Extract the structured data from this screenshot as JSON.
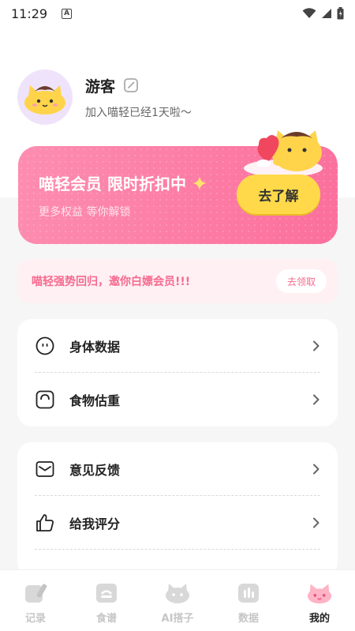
{
  "status_bar": {
    "time": "11:29",
    "notification_letter": "A"
  },
  "profile": {
    "name": "游客",
    "subtitle": "加入喵轻已经1天啦～"
  },
  "vip_card": {
    "title": "喵轻会员 限时折扣中",
    "subtitle": "更多权益 等你解锁",
    "button_label": "去了解"
  },
  "promo": {
    "text": "喵轻强势回归，邀你白嫖会员!!!",
    "button_label": "去领取"
  },
  "menu_group_1": [
    {
      "label": "身体数据",
      "icon": "face-icon"
    },
    {
      "label": "食物估重",
      "icon": "scale-icon"
    }
  ],
  "menu_group_2": [
    {
      "label": "意见反馈",
      "icon": "mail-icon"
    },
    {
      "label": "给我评分",
      "icon": "thumbs-up-icon"
    }
  ],
  "tabs": [
    {
      "label": "记录",
      "icon": "record-icon",
      "active": false
    },
    {
      "label": "食谱",
      "icon": "recipe-icon",
      "active": false
    },
    {
      "label": "AI搭子",
      "icon": "ai-cat-icon",
      "active": false
    },
    {
      "label": "数据",
      "icon": "data-icon",
      "active": false
    },
    {
      "label": "我的",
      "icon": "profile-cat-icon",
      "active": true
    }
  ],
  "colors": {
    "vip_gradient_start": "#fd8db1",
    "vip_gradient_end": "#fb6f9c",
    "vip_button": "#ffd94a",
    "promo_text": "#f66a8e",
    "avatar_bg": "#efe3fb"
  }
}
